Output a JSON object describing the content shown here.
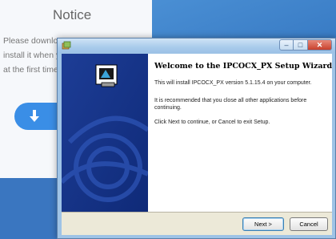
{
  "background_page": {
    "notice_title": "Notice",
    "notice_lines": [
      "Please downlo",
      "install it when y",
      "at the first time"
    ]
  },
  "window": {
    "title": "",
    "buttons": {
      "minimize": "–",
      "maximize": "□",
      "close": "✕"
    }
  },
  "wizard": {
    "heading": "Welcome to the IPCOCX_PX Setup Wizard",
    "paragraph1": "This will install IPCOCX_PX version 5.1.15.4 on your computer.",
    "paragraph2": "It is recommended that you close all other applications before continuing.",
    "paragraph3": "Click Next to continue, or Cancel to exit Setup."
  },
  "buttons": {
    "next": "Next >",
    "cancel": "Cancel"
  },
  "colors": {
    "sidebar": "#17368c",
    "button_bar": "#ece9d8",
    "titlebar": "#a9cbeb"
  }
}
